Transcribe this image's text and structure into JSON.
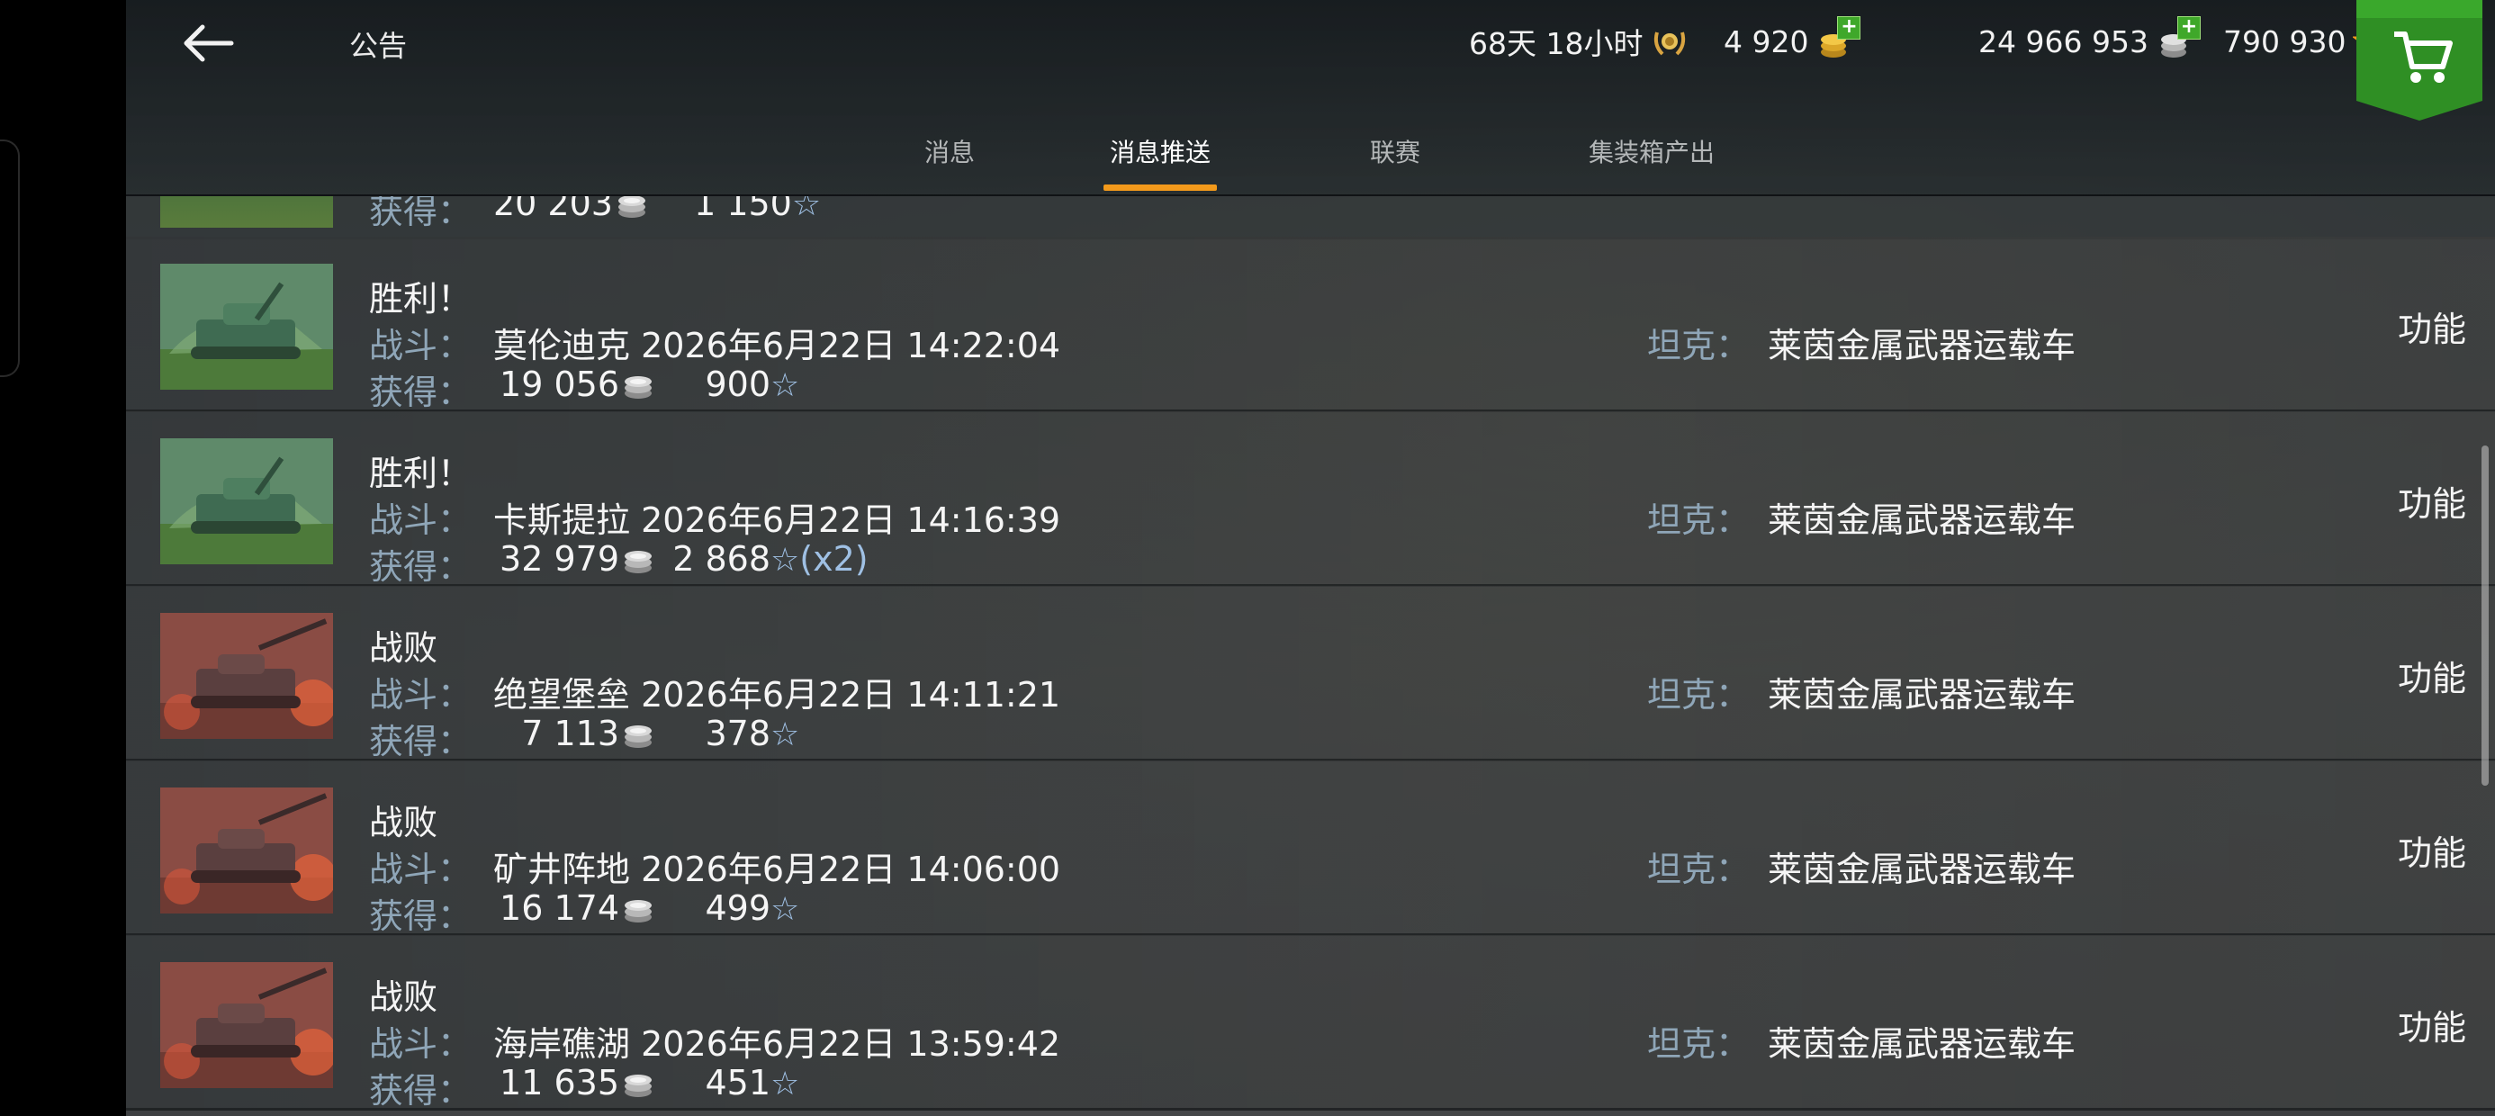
{
  "header": {
    "title": "公告",
    "premium_time": "68天 18小时",
    "gold": "4 920",
    "silver": "24 966 953",
    "free_xp": "790 930"
  },
  "tabs": [
    {
      "label": "消息",
      "active": false
    },
    {
      "label": "消息推送",
      "active": true
    },
    {
      "label": "联赛",
      "active": false
    },
    {
      "label": "集装箱产出",
      "active": false
    }
  ],
  "labels": {
    "battle": "战斗：",
    "earned": "获得：",
    "tank": "坦克：",
    "function": "功能"
  },
  "partial_row": {
    "credits": "20 203",
    "xp": "1 150"
  },
  "messages": [
    {
      "result": "胜利！",
      "outcome": "victory",
      "map": "莫伦迪克",
      "datetime": "2026年6月22日 14:22:04",
      "credits": "19 056",
      "xp": "900",
      "multiplier": "",
      "tank": "莱茵金属武器运载车"
    },
    {
      "result": "胜利！",
      "outcome": "victory",
      "map": "卡斯提拉",
      "datetime": "2026年6月22日 14:16:39",
      "credits": "32 979",
      "xp": "2 868",
      "multiplier": "(x2)",
      "tank": "莱茵金属武器运载车"
    },
    {
      "result": "战败",
      "outcome": "defeat",
      "map": "绝望堡垒",
      "datetime": "2026年6月22日 14:11:21",
      "credits": "7 113",
      "xp": "378",
      "multiplier": "",
      "tank": "莱茵金属武器运载车"
    },
    {
      "result": "战败",
      "outcome": "defeat",
      "map": "矿井阵地",
      "datetime": "2026年6月22日 14:06:00",
      "credits": "16 174",
      "xp": "499",
      "multiplier": "",
      "tank": "莱茵金属武器运载车"
    },
    {
      "result": "战败",
      "outcome": "defeat",
      "map": "海岸礁湖",
      "datetime": "2026年6月22日 13:59:42",
      "credits": "11 635",
      "xp": "451",
      "multiplier": "",
      "tank": "莱茵金属武器运载车"
    }
  ],
  "colors": {
    "accent_tab": "#f39a1b",
    "label_blue": "#8fa6b8",
    "shop_green": "#2f8f24"
  }
}
